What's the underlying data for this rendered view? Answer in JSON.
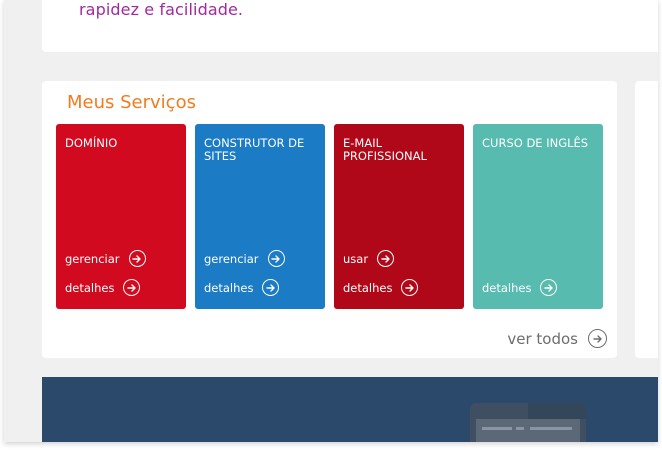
{
  "intro": {
    "text": "rapidez e facilidade."
  },
  "services": {
    "title": "Meus Serviços",
    "tiles": [
      {
        "title": "DOMÍNIO",
        "color": "#d10a20",
        "actions": [
          {
            "label": "gerenciar"
          },
          {
            "label": "detalhes"
          }
        ]
      },
      {
        "title": "CONSTRUTOR DE SITES",
        "color": "#1b7bc4",
        "actions": [
          {
            "label": "gerenciar"
          },
          {
            "label": "detalhes"
          }
        ]
      },
      {
        "title": "E-MAIL PROFISSIONAL",
        "color": "#b00818",
        "actions": [
          {
            "label": "usar"
          },
          {
            "label": "detalhes"
          }
        ]
      },
      {
        "title": "CURSO DE INGLÊS",
        "color": "#58bbb0",
        "actions": [
          {
            "label": "detalhes"
          }
        ]
      }
    ],
    "see_all_label": "ver todos"
  },
  "icons": {
    "action": "arrow-right-circle-icon"
  },
  "colors": {
    "accent_title": "#f07c1e",
    "intro_text": "#a3289e",
    "banner": "#2b4a6b"
  }
}
